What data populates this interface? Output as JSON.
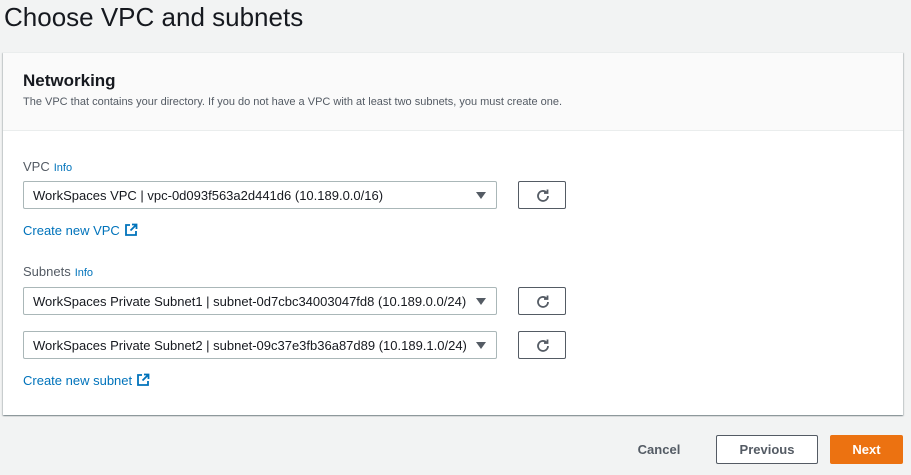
{
  "page": {
    "title": "Choose VPC and subnets"
  },
  "networking": {
    "title": "Networking",
    "description": "The VPC that contains your directory. If you do not have a VPC with at least two subnets, you must create one."
  },
  "vpc": {
    "label": "VPC",
    "info": "Info",
    "selected": "WorkSpaces VPC | vpc-0d093f563a2d441d6 (10.189.0.0/16)",
    "create_link": "Create new VPC"
  },
  "subnets": {
    "label": "Subnets",
    "info": "Info",
    "subnet1": "WorkSpaces Private Subnet1 | subnet-0d7cbc34003047fd8 (10.189.0.0/24)",
    "subnet2": "WorkSpaces Private Subnet2 | subnet-09c37e3fb36a87d89 (10.189.1.0/24)",
    "create_link": "Create new subnet"
  },
  "footer": {
    "cancel": "Cancel",
    "previous": "Previous",
    "next": "Next"
  },
  "colors": {
    "primary": "#ec7211",
    "link": "#0073bb",
    "text": "#16191f",
    "muted": "#545b64"
  },
  "icons": {
    "refresh": "refresh-icon",
    "external": "external-link-icon",
    "caret": "caret-down-icon"
  }
}
